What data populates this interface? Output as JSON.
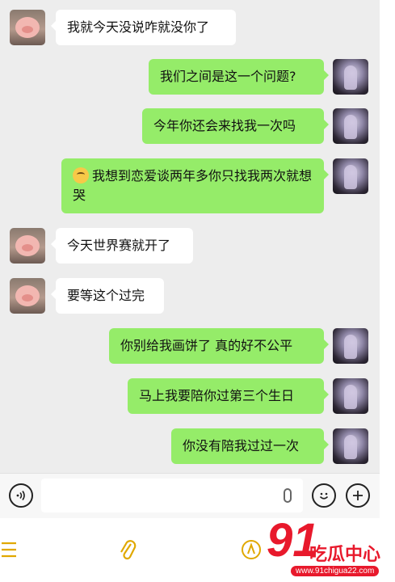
{
  "messages": [
    {
      "side": "in",
      "text": "我就今天没说咋就没你了"
    },
    {
      "side": "out",
      "text": "我们之间是这一个问题?"
    },
    {
      "side": "out",
      "text": "今年你还会来找我一次吗"
    },
    {
      "side": "out",
      "text": "我想到恋爱谈两年多你只找我两次就想哭"
    },
    {
      "side": "in",
      "text": "今天世界赛就开了"
    },
    {
      "side": "in",
      "text": "要等这个过完"
    },
    {
      "side": "out",
      "text": "你别给我画饼了 真的好不公平"
    },
    {
      "side": "out",
      "text": "马上我要陪你过第三个生日"
    },
    {
      "side": "out",
      "text": "你没有陪我过过一次"
    }
  ],
  "watermark": {
    "brand_number": "91",
    "brand_name": "吃瓜中心",
    "url": "www.91chigua22.com"
  }
}
